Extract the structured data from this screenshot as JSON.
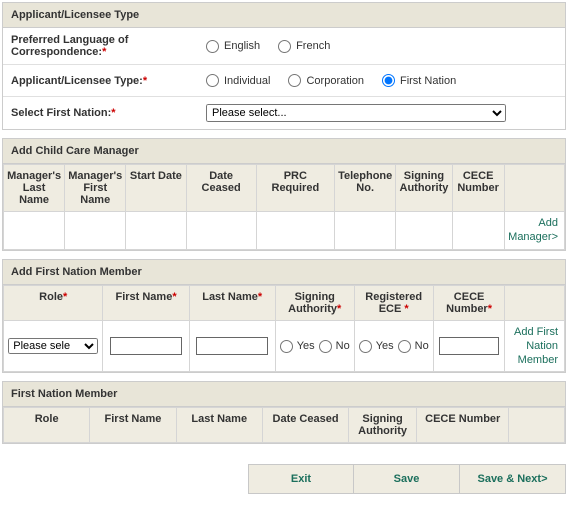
{
  "section1": {
    "title": "Applicant/Licensee Type",
    "lang_label": "Preferred Language of Correspondence:",
    "english": "English",
    "french": "French",
    "type_label": "Applicant/Licensee Type:",
    "individual": "Individual",
    "corporation": "Corporation",
    "first_nation": "First Nation",
    "select_fn_label": "Select First Nation:",
    "please_select": "Please select..."
  },
  "section2": {
    "title": "Add Child Care Manager",
    "cols": {
      "last": "Manager's Last Name",
      "first": "Manager's First Name",
      "start": "Start Date",
      "ceased": "Date Ceased",
      "prc": "PRC Required",
      "tel": "Telephone No.",
      "sign": "Signing Authority",
      "cece": "CECE Number"
    },
    "add_link": "Add Manager>"
  },
  "section3": {
    "title": "Add First Nation Member",
    "cols": {
      "role": "Role",
      "first": "First Name",
      "last": "Last Name",
      "sign": "Signing Authority",
      "reg": "Registered ECE ",
      "cece": "CECE Number"
    },
    "please_select_short": "Please sele",
    "yes": "Yes",
    "no": "No",
    "add_link": "Add First Nation Member"
  },
  "section4": {
    "title": "First Nation Member",
    "cols": {
      "role": "Role",
      "first": "First Name",
      "last": "Last Name",
      "ceased": "Date Ceased",
      "sign": "Signing Authority",
      "cece": "CECE Number"
    }
  },
  "buttons": {
    "exit": "Exit",
    "save": "Save",
    "savenext": "Save & Next>"
  },
  "star": "*"
}
